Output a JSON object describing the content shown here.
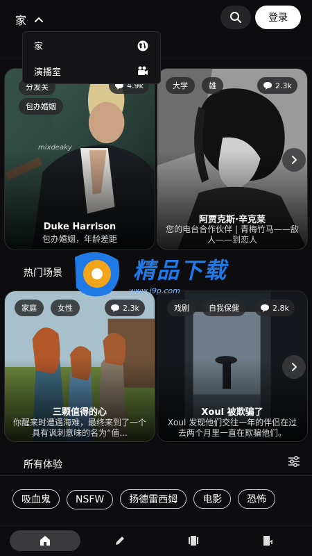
{
  "header": {
    "home_label": "家",
    "login_label": "登录"
  },
  "dropdown": {
    "items": [
      {
        "label": "家",
        "icon": "globe-icon"
      },
      {
        "label": "演播室",
        "icon": "camera-icon"
      }
    ]
  },
  "featured": {
    "cards": [
      {
        "tags": [
          "分发关",
          "包办婚姻"
        ],
        "count": "4.9k",
        "title": "Duke Harrison",
        "desc": "包办婚姻，年龄差距",
        "watermark": "mixdeaky"
      },
      {
        "tags": [
          "大学",
          "雄"
        ],
        "count": "2.3k",
        "title": "阿贾克斯·辛克莱",
        "desc": "您的电台合作伙伴 | 青梅竹马——敌人——到恋人"
      }
    ]
  },
  "popular": {
    "title": "热门场景",
    "cards": [
      {
        "tags": [
          "家庭",
          "女性"
        ],
        "count": "2.3k",
        "title": "三颗值得的心",
        "desc": "你醒来时遭遇海难，最终来到了一个具有讽刺意味的名为“值..."
      },
      {
        "tags": [
          "戏剧",
          "自我保健"
        ],
        "count": "2.8k",
        "title": "Xoul 被欺骗了",
        "desc": "Xoul 发现他们交往一年的伴侣在过去两个月里一直在欺骗他们。"
      }
    ]
  },
  "watermark": {
    "text": "精品下载",
    "url": "www.j9p.com"
  },
  "experiences": {
    "title": "所有体验",
    "chips": [
      "吸血鬼",
      "NSFW",
      "扬德雷西姆",
      "电影",
      "恐怖"
    ]
  },
  "nav": {
    "items": [
      "home-icon",
      "pencil-icon",
      "cards-icon",
      "door-icon"
    ]
  }
}
